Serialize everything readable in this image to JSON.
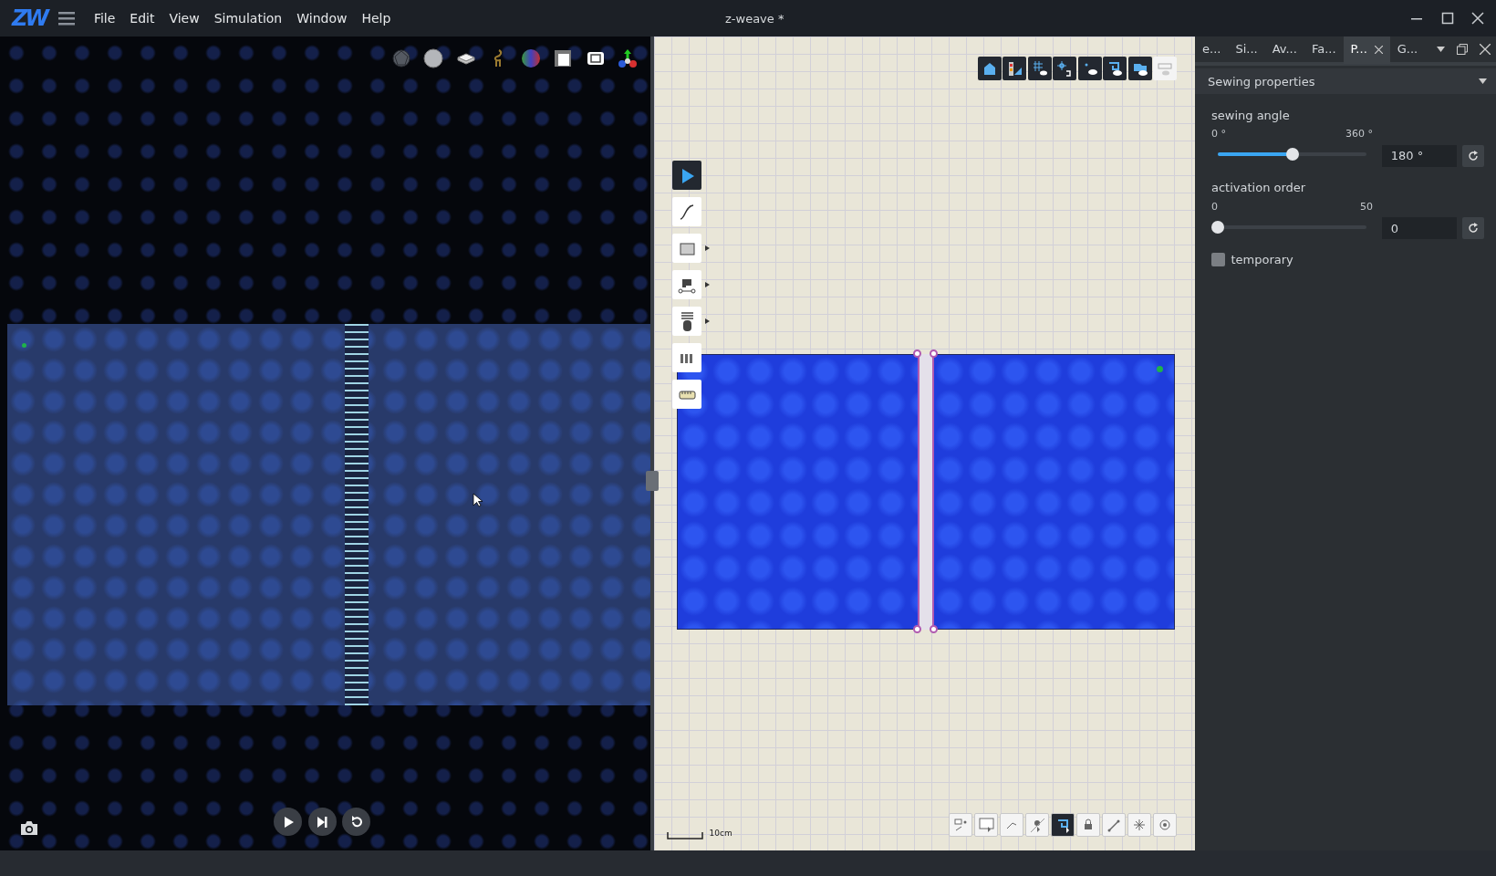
{
  "window": {
    "logo": "ZW",
    "title": "z-weave *"
  },
  "menu": [
    "File",
    "Edit",
    "View",
    "Simulation",
    "Window",
    "Help"
  ],
  "pattern_view": {
    "top_toolbar": [
      {
        "on": true
      },
      {
        "on": true
      },
      {
        "on": true
      },
      {
        "on": true
      },
      {
        "on": true
      },
      {
        "on": true
      },
      {
        "on": true
      },
      {
        "on": false
      }
    ],
    "tools": [
      {
        "selected": true,
        "flyout": false
      },
      {
        "selected": false,
        "flyout": false
      },
      {
        "selected": false,
        "flyout": true
      },
      {
        "selected": false,
        "flyout": true
      },
      {
        "selected": false,
        "flyout": true
      },
      {
        "selected": false,
        "flyout": false
      },
      {
        "selected": false,
        "flyout": false
      }
    ],
    "scale_label": "10cm",
    "bottom_toolbar": [
      {
        "selected": false
      },
      {
        "selected": false
      },
      {
        "selected": false
      },
      {
        "selected": false
      },
      {
        "selected": true
      },
      {
        "selected": false
      },
      {
        "selected": false
      },
      {
        "selected": false
      },
      {
        "selected": false
      }
    ]
  },
  "panel": {
    "tabs": [
      {
        "label": "e...",
        "selected": false
      },
      {
        "label": "Si...",
        "selected": false
      },
      {
        "label": "Av...",
        "selected": false
      },
      {
        "label": "Fa...",
        "selected": false
      },
      {
        "label": "P...",
        "selected": true
      },
      {
        "label": "G...",
        "selected": false
      }
    ],
    "section": {
      "title": "Sewing properties",
      "expanded": true
    },
    "sliders": [
      {
        "label": "sewing angle",
        "min": "0 °",
        "max": "360 °",
        "level": 0.5,
        "value": "180 °"
      },
      {
        "label": "activation order",
        "min": "0",
        "max": "50",
        "level": 0,
        "value": "0"
      }
    ],
    "checkbox": {
      "label": "temporary",
      "checked": false
    }
  }
}
